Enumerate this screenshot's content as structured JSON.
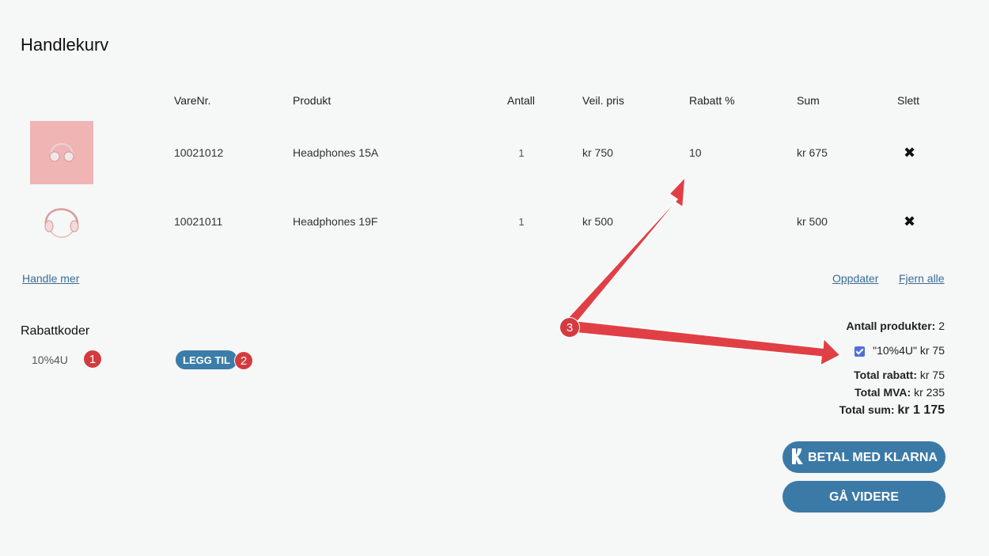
{
  "page": {
    "title": "Handlekurv"
  },
  "table": {
    "headers": [
      "VareNr.",
      "Produkt",
      "Antall",
      "Veil. pris",
      "Rabatt %",
      "Sum",
      "Slett"
    ],
    "rows": [
      {
        "varenr": "10021012",
        "produkt": "Headphones 15A",
        "antall": "1",
        "pris": "kr 750",
        "rabatt": "10",
        "sum": "kr 675",
        "image": "headphones-pink-thumbnail"
      },
      {
        "varenr": "10021011",
        "produkt": "Headphones 19F",
        "antall": "1",
        "pris": "kr 500",
        "rabatt": "",
        "sum": "kr 500",
        "image": "headphones-white-thumbnail"
      }
    ],
    "delete_icon": "close-icon"
  },
  "links": {
    "handle_mer": "Handle mer",
    "oppdater": "Oppdater",
    "fjern_alle": "Fjern alle"
  },
  "rabattkoder": {
    "title": "Rabattkoder",
    "input_value": "10%4U",
    "add_button": "LEGG TIL"
  },
  "summary": {
    "antall_label": "Antall produkter:",
    "antall_value": "2",
    "code_applied": "\"10%4U\"  kr 75",
    "total_rabatt_label": "Total rabatt:",
    "total_rabatt_value": "kr 75",
    "total_mva_label": "Total MVA:",
    "total_mva_value": "kr 235",
    "total_sum_label": "Total sum:",
    "total_sum_value": "kr 1 175"
  },
  "buttons": {
    "klarna": "BETAL MED KLARNA",
    "ga_videre": "GÅ VIDERE"
  },
  "annotations": [
    "1",
    "2",
    "3"
  ],
  "colors": {
    "accent": "#3b7aa7",
    "annotation": "#d33b3f",
    "link": "#3a6d94"
  }
}
